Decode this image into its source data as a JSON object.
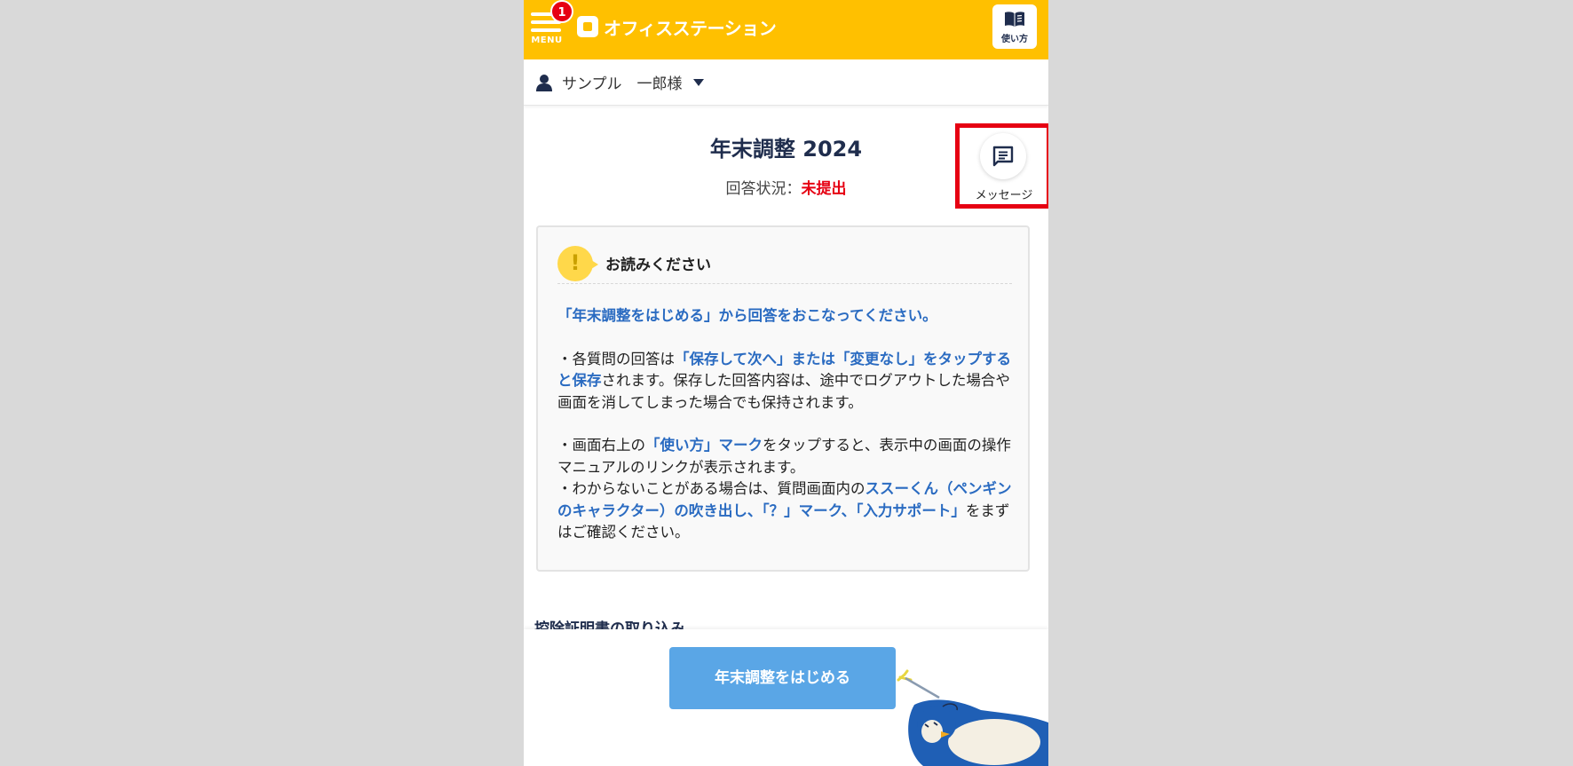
{
  "header": {
    "menu_label": "MENU",
    "menu_badge": "1",
    "logo_text": "オフィスステーション",
    "howto_label": "使い方",
    "brand_color": "#ffc000"
  },
  "user": {
    "name": "サンプル　一郎様"
  },
  "page": {
    "title": "年末調整 2024",
    "status_label": "回答状況：",
    "status_value": "未提出"
  },
  "message_button": {
    "label": "メッセージ"
  },
  "notice": {
    "title": "お読みください",
    "lead": "「年末調整をはじめる」から回答をおこなってください。",
    "p1_a": "・各質問の回答は",
    "p1_b": "「保存して次へ」または「変更なし」をタップすると保存",
    "p1_c": "されます。保存した回答内容は、途中でログアウトした場合や画面を消してしまった場合でも保持されます。",
    "p2_a": "・画面右上の",
    "p2_b": "「使い方」マーク",
    "p2_c": "をタップすると、表示中の画面の操作マニュアルのリンクが表示されます。",
    "p3_a": "・わからないことがある場合は、質問画面内の",
    "p3_b": "ススーくん（ペンギンのキャラクター）の吹き出し、「？」マーク、「入力サポート」",
    "p3_c": "をまずはご確認ください。"
  },
  "section_peek": "控除証明書の取り込み",
  "bottom": {
    "start_label": "年末調整をはじめる"
  },
  "icons": {
    "menu": "hamburger-icon",
    "howto": "book-icon",
    "user": "person-icon",
    "message": "chat-icon",
    "warning": "exclamation-icon",
    "mascot": "penguin-mascot"
  },
  "colors": {
    "status_red": "#e60012",
    "link_blue": "#2a6bc1",
    "button_blue": "#5aa6e6"
  }
}
